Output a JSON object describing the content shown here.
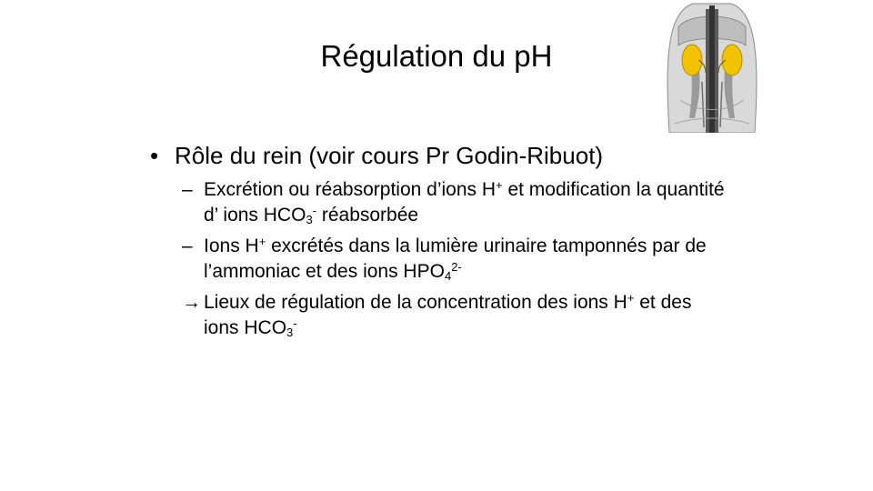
{
  "slide": {
    "title": "Régulation du pH",
    "bullet": "Rôle du rein (voir cours Pr Godin-Ribuot)",
    "dash": "–",
    "arrow": "→",
    "sub1": {
      "t1": "Excrétion ou réabsorption d’ions H",
      "sup1": "+",
      "t2": " et modification la quantité d’ ions HCO",
      "sub1": "3",
      "sup2": "-",
      "t3": " réabsorbée"
    },
    "sub2": {
      "t1": "Ions H",
      "sup1": "+",
      "t2": " excrétés dans la lumière urinaire tamponnés par de l’ammoniac et des ions HPO",
      "sub1": "4",
      "sup2": "2-"
    },
    "sub3": {
      "t1": " Lieux de régulation de la concentration des ions H",
      "sup1": "+",
      "t2": " et des ions HCO",
      "sub1": "3",
      "sup2": "-"
    }
  }
}
